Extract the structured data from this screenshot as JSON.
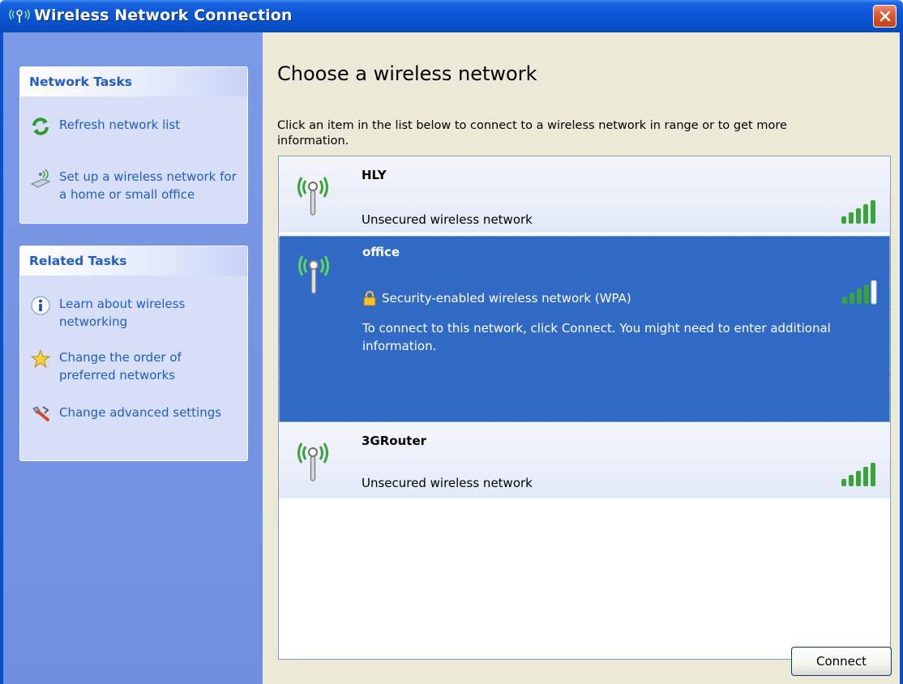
{
  "window": {
    "title": "Wireless Network Connection"
  },
  "left_pane": {
    "network_tasks": {
      "header": "Network Tasks",
      "items": [
        {
          "label": "Refresh network list",
          "icon": "refresh-icon"
        },
        {
          "label": "Set up a wireless network for a home or small office",
          "icon": "wireless-setup-icon"
        }
      ]
    },
    "related_tasks": {
      "header": "Related Tasks",
      "items": [
        {
          "label": "Learn about wireless networking",
          "icon": "info-icon"
        },
        {
          "label": "Change the order of preferred networks",
          "icon": "star-icon"
        },
        {
          "label": "Change advanced settings",
          "icon": "settings-icon"
        }
      ]
    }
  },
  "main": {
    "heading": "Choose a wireless network",
    "instructions": "Click an item in the list below to connect to a wireless network in range or to get more information.",
    "networks": [
      {
        "name": "HLY",
        "status": "Unsecured wireless network",
        "secured": false,
        "selected": false,
        "signal_bars": 5
      },
      {
        "name": "office",
        "status": "Security-enabled wireless network (WPA)",
        "secured": true,
        "selected": true,
        "signal_bars": 4,
        "detail": "To connect to this network, click Connect. You might need to enter additional information."
      },
      {
        "name": "3GRouter",
        "status": "Unsecured wireless network",
        "secured": false,
        "selected": false,
        "signal_bars": 5
      }
    ],
    "connect_label": "Connect"
  },
  "colors": {
    "titlebar": "#0a4fc8",
    "task_link": "#215dc6",
    "selection": "#316ac5",
    "signal_green": "#3aa33a"
  }
}
